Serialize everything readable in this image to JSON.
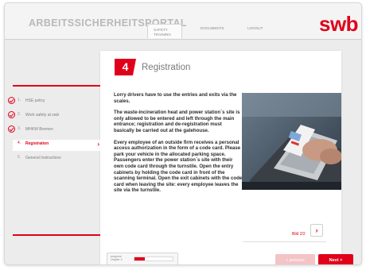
{
  "header": {
    "portal_title": "ARBEITSSICHERHEITSPORTAL",
    "tabs": [
      {
        "label": "SAFETY TRAINING",
        "active": true
      },
      {
        "label": "DOCUMENTS",
        "active": false
      },
      {
        "label": "LOGOUT",
        "active": false
      }
    ],
    "logo": "swb"
  },
  "sidebar": {
    "items": [
      {
        "num": "1.",
        "label": "HSE policy",
        "done": true
      },
      {
        "num": "2.",
        "label": "Work safety at swb",
        "done": true
      },
      {
        "num": "3.",
        "label": "MHKW Bremen",
        "done": true
      },
      {
        "num": "4.",
        "label": "Registration",
        "active": true
      },
      {
        "num": "5.",
        "label": "General Instructions"
      }
    ]
  },
  "main": {
    "step_number": "4",
    "title": "Registration",
    "paragraphs": [
      "Lorry drivers have to use the entries and exits via the scales.",
      "The waste-incineration heat and power station´s site is only allowed to be entered and left through the main entrance; registration and de-registration must basically be carried out at the gatehouse.",
      "Every employee of an outside firm receives a personal access authorization in the form of a code card. Please park your vehicle in the allocated parking space. Passengers enter the power station´s site with their own code card through the turnstile. Open the entry cabinets by holding the code card in front of the scanning terminal. Open the exit cabinets with the code card when leaving the site: every employee leaves the site via the turnstile."
    ],
    "image_counter": "Bild 2/2",
    "next_image_icon": "chevron-right-icon"
  },
  "progress": {
    "label": "progress chapter 4",
    "fraction": 0.28
  },
  "footer": {
    "previous_label": "< previous",
    "next_label": "Next >"
  },
  "colors": {
    "accent": "#e0001a",
    "accent_light": "#f3c3c6"
  }
}
